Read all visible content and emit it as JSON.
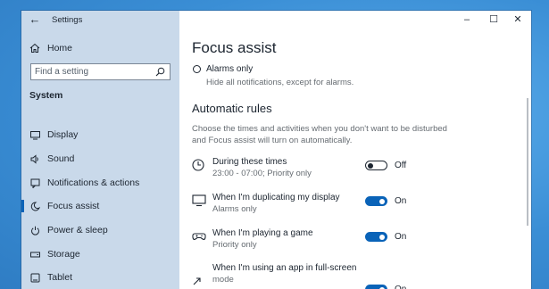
{
  "window": {
    "title": "Settings",
    "minimize": "–",
    "maximize": "☐",
    "close": "✕",
    "back": "←"
  },
  "sidebar": {
    "home_label": "Home",
    "search_placeholder": "Find a setting",
    "section_title": "System",
    "items": [
      {
        "label": "Display",
        "icon": "display-icon",
        "active": false
      },
      {
        "label": "Sound",
        "icon": "sound-icon",
        "active": false
      },
      {
        "label": "Notifications & actions",
        "icon": "notifications-icon",
        "active": false
      },
      {
        "label": "Focus assist",
        "icon": "moon-icon",
        "active": true
      },
      {
        "label": "Power & sleep",
        "icon": "power-icon",
        "active": false
      },
      {
        "label": "Storage",
        "icon": "storage-icon",
        "active": false
      },
      {
        "label": "Tablet",
        "icon": "tablet-icon",
        "active": false
      }
    ]
  },
  "content": {
    "page_title": "Focus assist",
    "alarms_option": {
      "label": "Alarms only",
      "description": "Hide all notifications, except for alarms."
    },
    "rules_title": "Automatic rules",
    "rules_description": "Choose the times and activities when you don't want to be disturbed and Focus assist will turn on automatically.",
    "rules": [
      {
        "title": "During these times",
        "subtitle": "23:00 - 07:00; Priority only",
        "state": "Off",
        "on": false,
        "icon": "clock-icon"
      },
      {
        "title": "When I'm duplicating my display",
        "subtitle": "Alarms only",
        "state": "On",
        "on": true,
        "icon": "monitor-icon"
      },
      {
        "title": "When I'm playing a game",
        "subtitle": "Priority only",
        "state": "On",
        "on": true,
        "icon": "gamepad-icon"
      },
      {
        "title": "When I'm using an app in full-screen",
        "subtitle": "mode",
        "state": "On",
        "on": true,
        "icon": "fullscreen-icon"
      }
    ]
  },
  "colors": {
    "accent": "#0a63b8",
    "sidebar_bg": "#c9d9ea",
    "desktop": "#3b8fd6"
  }
}
